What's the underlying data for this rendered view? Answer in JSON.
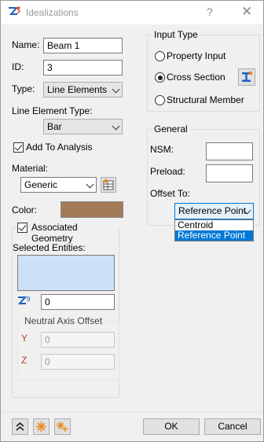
{
  "window": {
    "title": "Idealizations",
    "help": "?",
    "close": "✕"
  },
  "left": {
    "name_label": "Name:",
    "name_value": "Beam 1",
    "id_label": "ID:",
    "id_value": "3",
    "type_label": "Type:",
    "type_value": "Line Elements",
    "line_type_label": "Line Element Type:",
    "line_type_value": "Bar",
    "add_to_analysis": "Add To Analysis",
    "material_label": "Material:",
    "material_value": "Generic",
    "color_label": "Color:",
    "color_hex": "#a47b58",
    "assoc_geometry": "Associated Geometry",
    "selected_entities": "Selected Entities:",
    "entity_count": "0",
    "neutral_axis": "Neutral Axis Offset",
    "y_label": "Y",
    "y_value": "0",
    "z_label": "Z",
    "z_value": "0"
  },
  "right": {
    "input_type_label": "Input Type",
    "opt_property": "Property Input",
    "opt_cross_section": "Cross Section",
    "opt_structural": "Structural Member",
    "general_label": "General",
    "nsm_label": "NSM:",
    "nsm_value": "",
    "preload_label": "Preload:",
    "preload_value": "",
    "offset_label": "Offset To:",
    "offset_value": "Reference Point",
    "offset_options": [
      "Centroid",
      "Reference Point"
    ]
  },
  "footer": {
    "ok": "OK",
    "cancel": "Cancel"
  },
  "colors": {
    "selection": "#0078d7",
    "list_bg": "#cce0f8"
  }
}
